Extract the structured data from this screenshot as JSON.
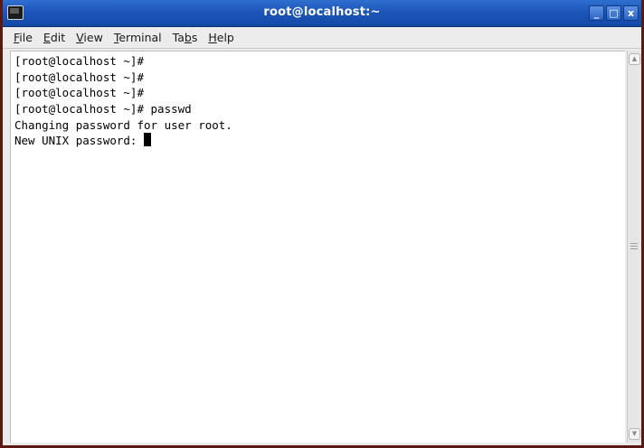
{
  "window": {
    "title": "root@localhost:~",
    "controls": {
      "minimize": "_",
      "maximize": "□",
      "close": "x"
    },
    "colors": {
      "titlebar": "#1d56b8",
      "frame": "#5a1a14"
    }
  },
  "menubar": {
    "items": [
      {
        "mnemonic": "F",
        "rest": "ile"
      },
      {
        "mnemonic": "E",
        "rest": "dit"
      },
      {
        "mnemonic": "V",
        "rest": "iew"
      },
      {
        "mnemonic": "T",
        "rest": "erminal"
      },
      {
        "pre": "Ta",
        "mnemonic": "b",
        "rest": "s"
      },
      {
        "mnemonic": "H",
        "rest": "elp"
      }
    ]
  },
  "terminal": {
    "lines": [
      "[root@localhost ~]#",
      "[root@localhost ~]#",
      "[root@localhost ~]#",
      "[root@localhost ~]# passwd",
      "Changing password for user root.",
      "New UNIX password: "
    ]
  },
  "scrollbar": {
    "up_icon": "scroll-up-arrow-icon",
    "down_icon": "scroll-down-arrow-icon"
  }
}
